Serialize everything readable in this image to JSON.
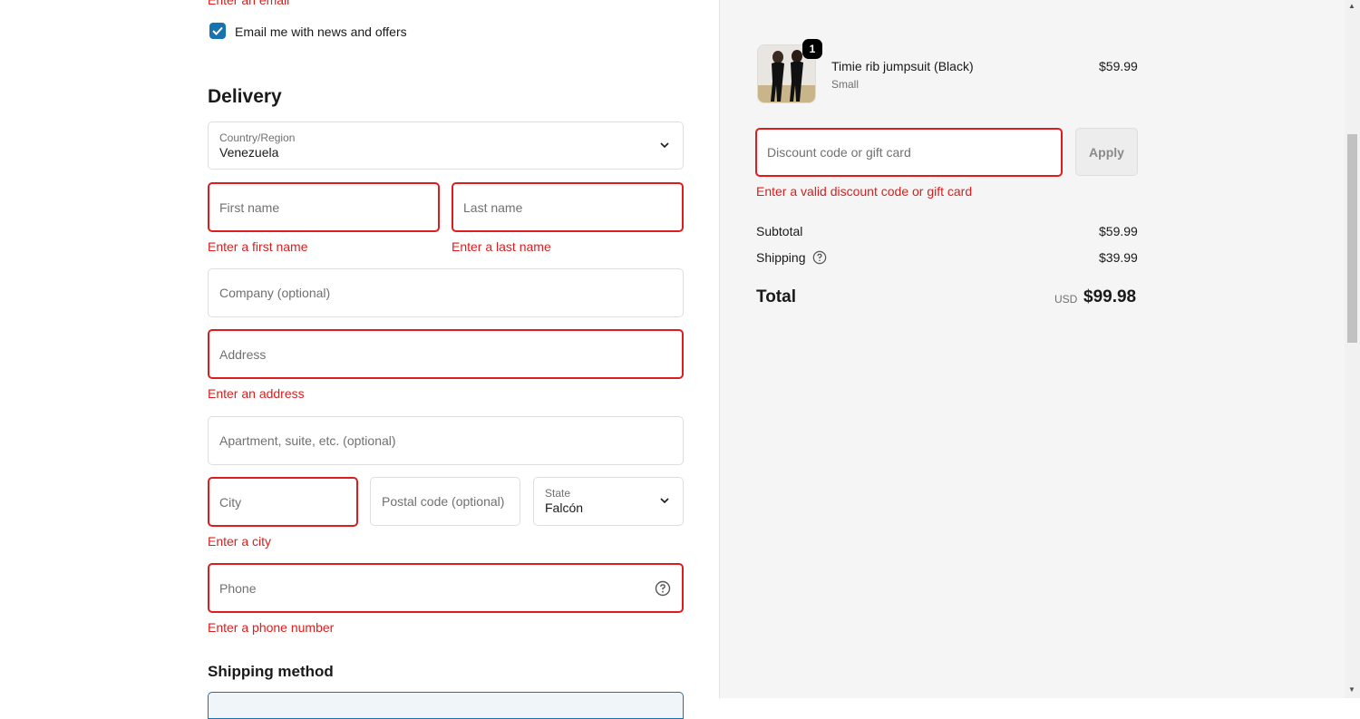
{
  "contact": {
    "email_error": "Enter an email",
    "newsletter_label": "Email me with news and offers",
    "newsletter_checked": true
  },
  "delivery": {
    "heading": "Delivery",
    "country_label": "Country/Region",
    "country_value": "Venezuela",
    "first_name_placeholder": "First name",
    "first_name_error": "Enter a first name",
    "last_name_placeholder": "Last name",
    "last_name_error": "Enter a last name",
    "company_placeholder": "Company (optional)",
    "address_placeholder": "Address",
    "address_error": "Enter an address",
    "apartment_placeholder": "Apartment, suite, etc. (optional)",
    "city_placeholder": "City",
    "city_error": "Enter a city",
    "postal_placeholder": "Postal code (optional)",
    "state_label": "State",
    "state_value": "Falcón",
    "phone_placeholder": "Phone",
    "phone_error": "Enter a phone number"
  },
  "shipping_method": {
    "heading": "Shipping method"
  },
  "summary": {
    "product": {
      "name": "Timie rib jumpsuit (Black)",
      "variant": "Small",
      "price": "$59.99",
      "quantity": "1"
    },
    "discount_placeholder": "Discount code or gift card",
    "apply_label": "Apply",
    "discount_error": "Enter a valid discount code or gift card",
    "subtotal_label": "Subtotal",
    "subtotal_value": "$59.99",
    "shipping_label": "Shipping",
    "shipping_value": "$39.99",
    "total_label": "Total",
    "currency": "USD",
    "total_value": "$99.98"
  },
  "colors": {
    "error": "#dd1d1d",
    "accent": "#1773b0",
    "summary_bg": "#f5f5f5"
  }
}
